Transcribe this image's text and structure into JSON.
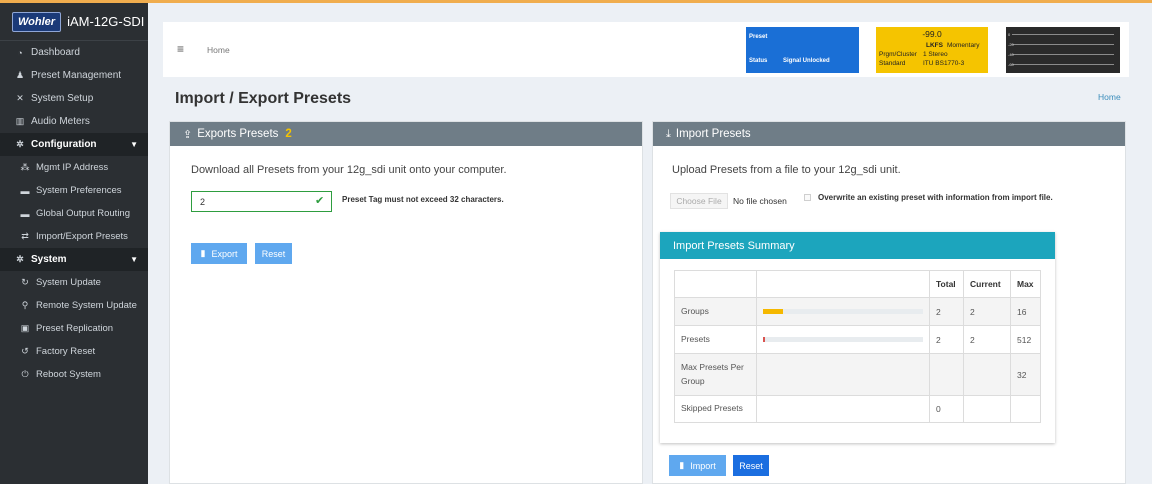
{
  "app": {
    "logo": "Wohler",
    "title": "iAM-12G-SDI"
  },
  "sidebar": {
    "items": [
      {
        "label": "Dashboard",
        "icon": "dashboard-icon",
        "glyph": "◔"
      },
      {
        "label": "Preset Management",
        "icon": "users-icon",
        "glyph": "♟"
      },
      {
        "label": "System Setup",
        "icon": "tools-icon",
        "glyph": "✕"
      },
      {
        "label": "Audio Meters",
        "icon": "bar-chart-icon",
        "glyph": "▥"
      }
    ],
    "config_section": {
      "label": "Configuration",
      "glyph": "✲"
    },
    "config_items": [
      {
        "label": "Mgmt IP Address",
        "icon": "network-icon",
        "glyph": "⁂"
      },
      {
        "label": "System Preferences",
        "icon": "keyboard-icon",
        "glyph": "▬"
      },
      {
        "label": "Global Output Routing",
        "icon": "keyboard-icon",
        "glyph": "▬"
      },
      {
        "label": "Import/Export Presets",
        "icon": "exchange-icon",
        "glyph": "⇄"
      }
    ],
    "system_section": {
      "label": "System",
      "glyph": "✲"
    },
    "system_items": [
      {
        "label": "System Update",
        "icon": "refresh-icon",
        "glyph": "↻"
      },
      {
        "label": "Remote System Update",
        "icon": "satellite-icon",
        "glyph": "⚲"
      },
      {
        "label": "Preset Replication",
        "icon": "copy-icon",
        "glyph": "▣"
      },
      {
        "label": "Factory Reset",
        "icon": "undo-icon",
        "glyph": "↺"
      },
      {
        "label": "Reboot System",
        "icon": "power-icon",
        "glyph": "⏻"
      }
    ]
  },
  "header": {
    "breadcrumb": "Home",
    "preset": {
      "title": "Preset",
      "status_label": "Status",
      "status_value": "Signal Unlocked"
    },
    "lkfs": {
      "value": "-99.0",
      "label": "LKFS",
      "mode": "Momentary",
      "cluster_label": "Prgm/Cluster",
      "cluster_value": "1  Stereo",
      "standard_label": "Standard",
      "standard_value": "ITU BS1770-3"
    },
    "meter_labels": [
      "0",
      "-20",
      "-40",
      "-60"
    ]
  },
  "page": {
    "title": "Import / Export Presets",
    "breadcrumb_home": "Home"
  },
  "export_panel": {
    "title": "Exports Presets",
    "badge": "2",
    "description": "Download all Presets from your 12g_sdi unit onto your computer.",
    "tag_value": "2",
    "tag_hint": "Preset Tag must not exceed 32 characters.",
    "export_label": "Export",
    "reset_label": "Reset"
  },
  "import_panel": {
    "title": "Import Presets",
    "description": "Upload Presets from a file to your 12g_sdi unit.",
    "choose_file": "Choose File",
    "no_file": "No file chosen",
    "overwrite_label": "Overwrite an existing preset with information from import file.",
    "import_label": "Import",
    "reset_label": "Reset",
    "summary": {
      "title": "Import Presets Summary",
      "columns": [
        "",
        "",
        "Total",
        "Current",
        "Max"
      ],
      "rows": [
        {
          "label": "Groups",
          "total": "2",
          "current": "2",
          "max": "16",
          "progress": 0.125,
          "bar_color": "#f5b800"
        },
        {
          "label": "Presets",
          "total": "2",
          "current": "2",
          "max": "512",
          "progress": 0.004,
          "bar_color": "#d9534f"
        },
        {
          "label": "Max Presets Per Group",
          "total": "",
          "current": "",
          "max": "32"
        },
        {
          "label": "Skipped Presets",
          "total": "0",
          "current": "",
          "max": ""
        }
      ]
    }
  }
}
